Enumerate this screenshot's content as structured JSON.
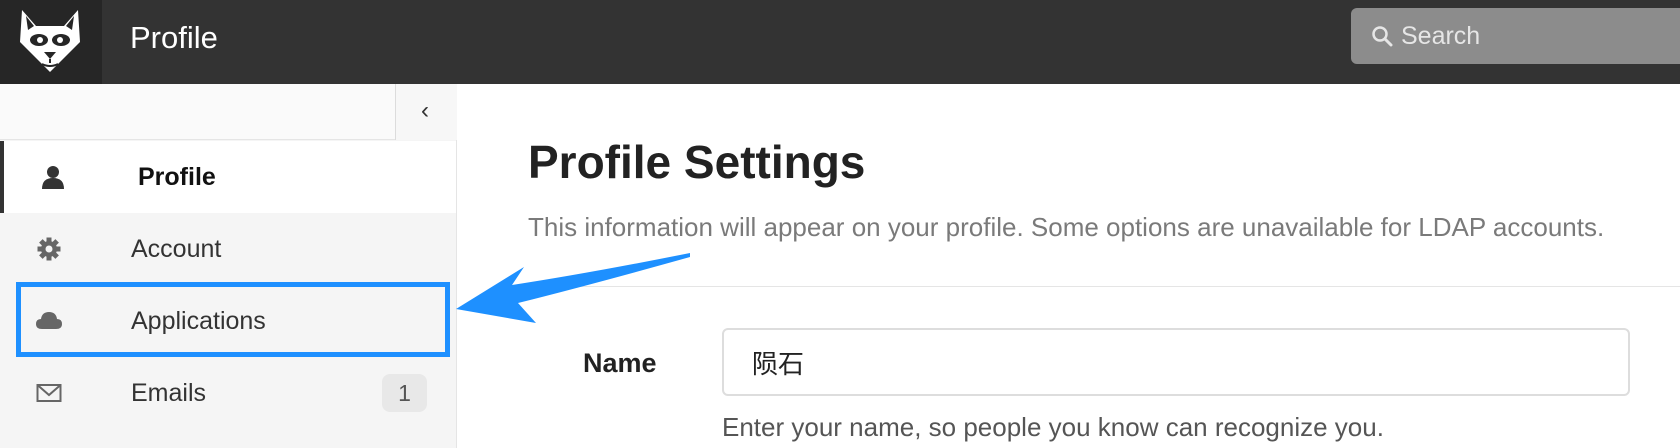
{
  "header": {
    "title": "Profile",
    "search": {
      "placeholder": "Search",
      "value": ""
    }
  },
  "sidebar": {
    "collapse_label": "‹",
    "items": [
      {
        "label": "Profile",
        "icon": "user-icon",
        "active": true
      },
      {
        "label": "Account",
        "icon": "gear-icon"
      },
      {
        "label": "Applications",
        "icon": "cloud-icon",
        "highlighted": true
      },
      {
        "label": "Emails",
        "icon": "envelope-icon",
        "badge": "1"
      }
    ]
  },
  "main": {
    "title": "Profile Settings",
    "subtitle": "This information will appear on your profile. Some options are unavailable for LDAP accounts.",
    "name_field": {
      "label": "Name",
      "value": "陨石",
      "help": "Enter your name, so people you know can recognize you."
    }
  },
  "colors": {
    "header_bg": "#333333",
    "annotation": "#1e90ff"
  }
}
